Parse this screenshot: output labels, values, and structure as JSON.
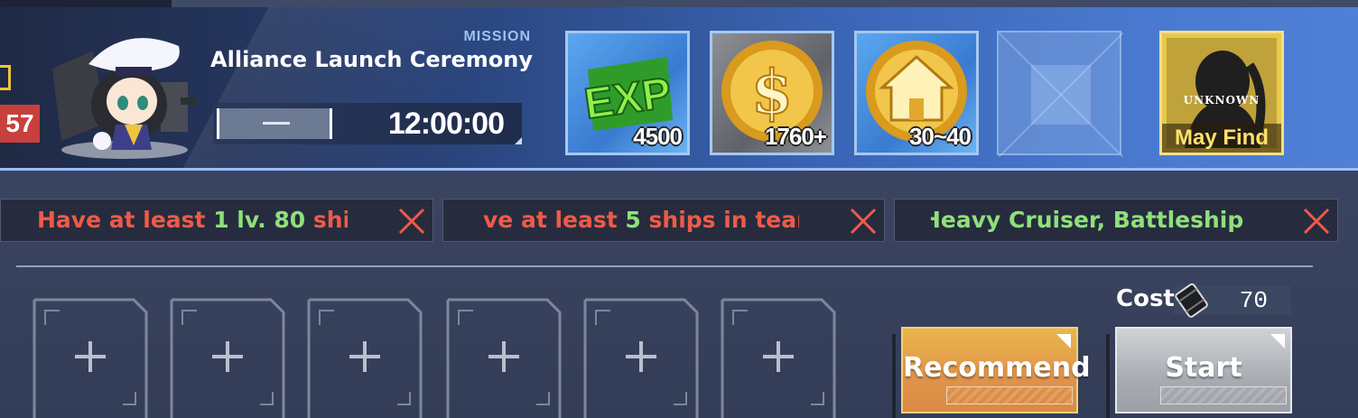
{
  "mission": {
    "label": "MISSION",
    "name": "Alliance Launch Ceremony",
    "timer": "12:00:00",
    "level_badge": "57",
    "timer_slider_icon": "minus-icon"
  },
  "rewards": [
    {
      "kind": "exp",
      "icon": "exp-icon",
      "count": "4500"
    },
    {
      "kind": "coin",
      "icon": "gold-coin-icon",
      "count": "1760+"
    },
    {
      "kind": "dorm",
      "icon": "house-coin-icon",
      "count": "30~40"
    },
    {
      "kind": "empty",
      "icon": "empty-slot-icon",
      "count": ""
    },
    {
      "kind": "unknown",
      "icon": "silhouette-icon",
      "label": "UNKNOWN",
      "caption": "May Find"
    }
  ],
  "conditions": [
    {
      "part1": "Have at least ",
      "part2": "1 lv. 80",
      "part3": " ship",
      "status_icon": "x-icon"
    },
    {
      "part1": "ve at least ",
      "part2": "5",
      "part3": " ships in team",
      "status_icon": "x-icon"
    },
    {
      "part1": "",
      "part2": "Heavy Cruiser, Battleship",
      "part3": "",
      "status_icon": "x-icon"
    }
  ],
  "fleet_slots": [
    {
      "icon": "plus-icon"
    },
    {
      "icon": "plus-icon"
    },
    {
      "icon": "plus-icon"
    },
    {
      "icon": "plus-icon"
    },
    {
      "icon": "plus-icon"
    },
    {
      "icon": "plus-icon"
    }
  ],
  "cost": {
    "label": "Cost",
    "value": "70",
    "icon": "oil-barrel-icon"
  },
  "buttons": {
    "recommend": "Recommend",
    "start": "Start"
  },
  "colors": {
    "condition_fail": "#ef5a48",
    "condition_value": "#8fe07a",
    "recommend": "#e0934a",
    "start": "#a9adb3"
  }
}
